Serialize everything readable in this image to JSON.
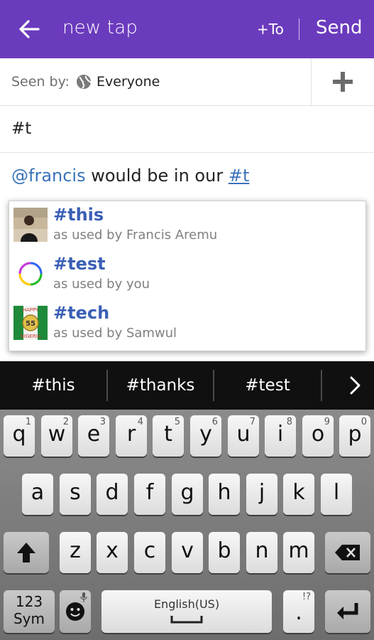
{
  "header": {
    "title": "new tap",
    "to_label": "+To",
    "send_label": "Send"
  },
  "audience": {
    "label": "Seen by:",
    "value": "Everyone",
    "icon": "globe-icon"
  },
  "tag_field": {
    "value": "#t"
  },
  "message": {
    "mention": "@francis",
    "middle": " would be in our ",
    "hashtag": "#t"
  },
  "suggestions": [
    {
      "tag": "#this",
      "by": "as used by Francis Aremu"
    },
    {
      "tag": "#test",
      "by": "as used by you"
    },
    {
      "tag": "#tech",
      "by": "as used by Samwul"
    }
  ],
  "tech_thumb": {
    "line1": "HAPPY",
    "number": "55",
    "line2": "NIGERIA"
  },
  "keyboard_suggestions": [
    "#this",
    "#thanks",
    "#test"
  ],
  "keyboard": {
    "row1": [
      {
        "key": "q",
        "sub": "1"
      },
      {
        "key": "w",
        "sub": "2"
      },
      {
        "key": "e",
        "sub": "3"
      },
      {
        "key": "r",
        "sub": "4"
      },
      {
        "key": "t",
        "sub": "5"
      },
      {
        "key": "y",
        "sub": "6"
      },
      {
        "key": "u",
        "sub": "7"
      },
      {
        "key": "i",
        "sub": "8"
      },
      {
        "key": "o",
        "sub": "9"
      },
      {
        "key": "p",
        "sub": "0"
      }
    ],
    "row2": [
      "a",
      "s",
      "d",
      "f",
      "g",
      "h",
      "j",
      "k",
      "l"
    ],
    "row3": [
      "z",
      "x",
      "c",
      "v",
      "b",
      "n",
      "m"
    ],
    "sym_line1": "123",
    "sym_line2": "Sym",
    "space_label": "English(US)",
    "period_key": ".",
    "period_sub": "!?"
  },
  "colors": {
    "app_bar": "#6b3bbd",
    "link": "#3a73b8",
    "hashtag_bold": "#3a5fb5"
  }
}
